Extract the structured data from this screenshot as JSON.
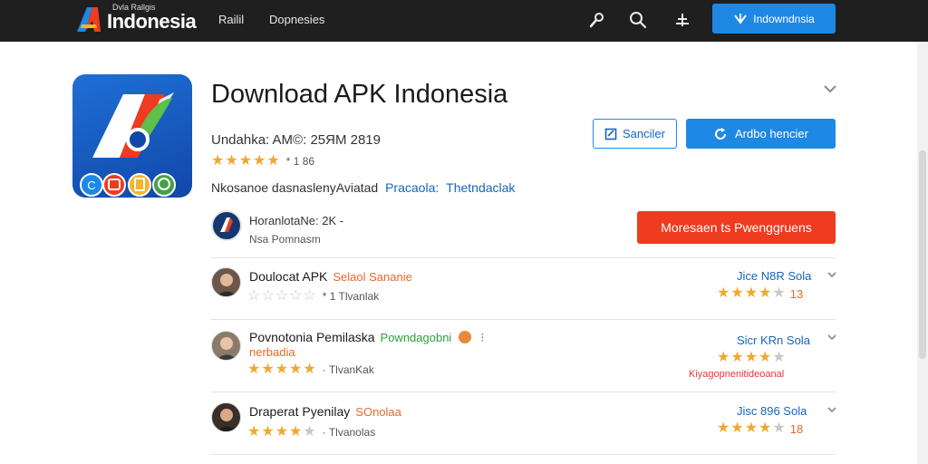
{
  "header": {
    "logo_small": "Dvla Rallgis",
    "logo_big": "Indonesia",
    "nav": [
      "Railil",
      "Doрnesies"
    ],
    "cta_label": "Indowndnsia",
    "colors": {
      "bar": "#1f1f1f",
      "accent": "#1e88e5"
    }
  },
  "app": {
    "title": "Download APK Indonesia",
    "meta": "Undahka: AM©: 25ЯM 2819",
    "rating_stars": 4.5,
    "rating_text": "* 1 86",
    "description": "Nkosanoe dasnaslenyAviatad",
    "desc_link1": "Pracaola:",
    "desc_link2": "Thetndaclak",
    "btn_outline": "Sanciler",
    "btn_primary": "Ardbo hencier",
    "developer_name": "HoranlotaNe: 2K -",
    "developer_sub": "Nsа Pomnasm",
    "btn_red": "Moresaen ts Pwenggruens"
  },
  "items": [
    {
      "title": "Doulocat APK",
      "tag": "Selaol Sananie",
      "tag_color": "#e46a2a",
      "sub": "",
      "stars": 0,
      "rating_text": "* 1 Tlvanlak",
      "right_top": "Jice N8R  Sola",
      "right_stars": 4,
      "right_num": "13",
      "note": ""
    },
    {
      "title": "Povnotonia Pemilaska",
      "tag": "Powndagobni",
      "tag_color": "#2e9e3a",
      "sub": "nerbadia",
      "stars": 4.5,
      "rating_text": "· TlvanKak",
      "right_top": "Sicr KRn  Sola",
      "right_stars": 4,
      "right_num": "",
      "note": "Kiyagopnenitideoanal"
    },
    {
      "title": "Draperat Pyenilay",
      "tag": "SOnolaa",
      "tag_color": "#e46a2a",
      "sub": "",
      "stars": 4,
      "rating_text": "· Tlvanolas",
      "right_top": "Jisc 896  Sola",
      "right_stars": 4,
      "right_num": "18",
      "note": ""
    }
  ],
  "icons": [
    "app-logo",
    "microphone-icon",
    "search-icon",
    "filter-icon",
    "refresh-icon",
    "edit-icon",
    "chevron-down-icon"
  ]
}
